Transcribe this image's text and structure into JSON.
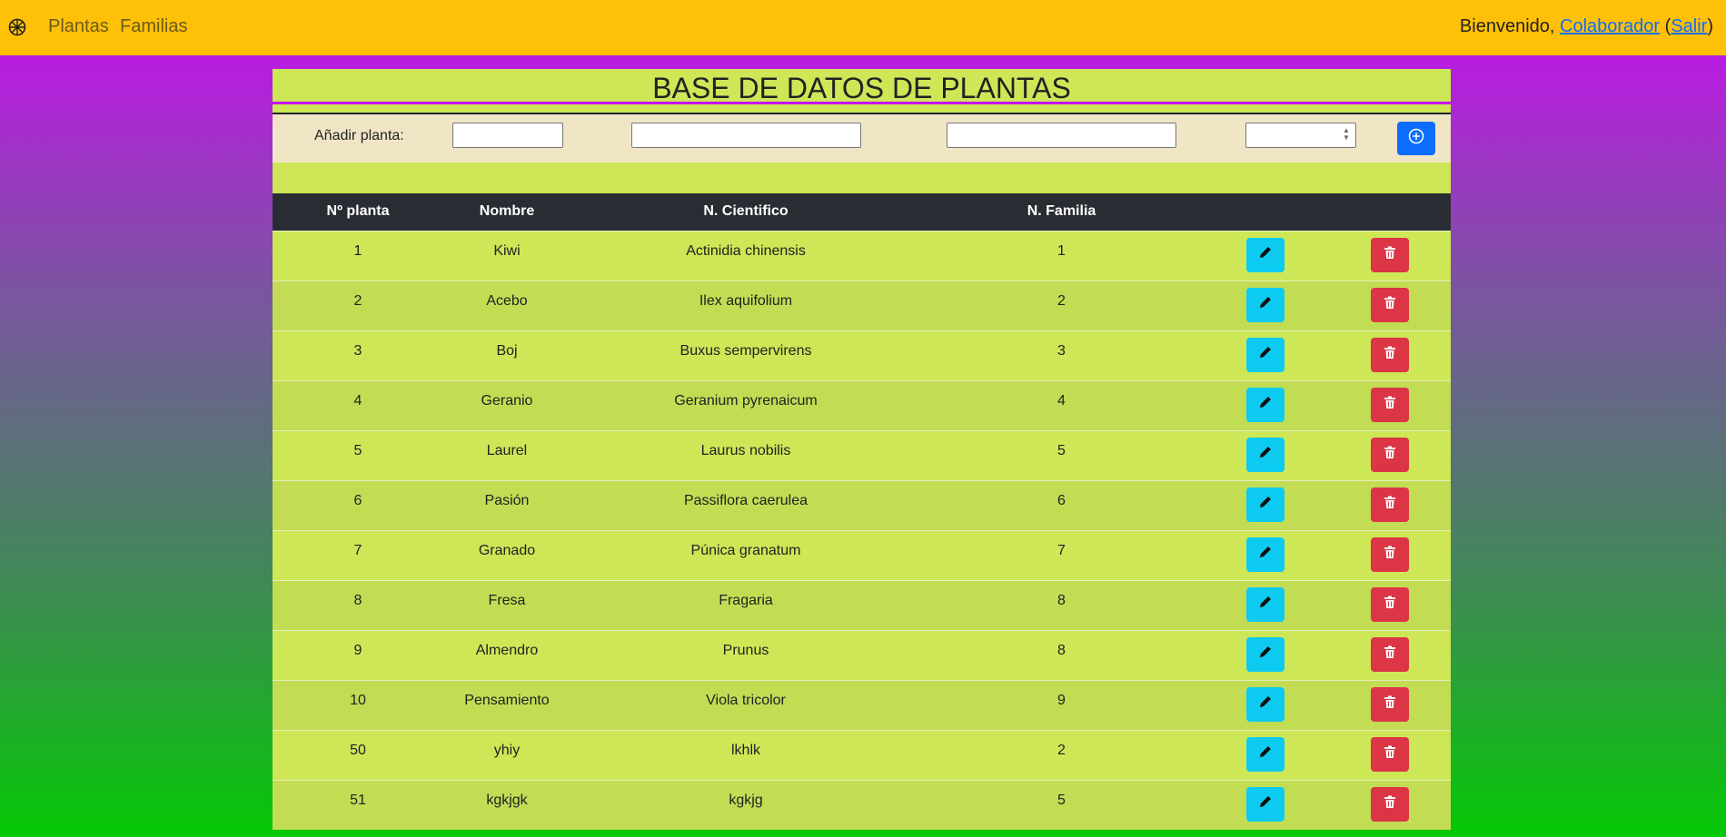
{
  "navbar": {
    "links": [
      "Plantas",
      "Familias"
    ],
    "welcome_prefix": "Bienvenido, ",
    "user": "Colaborador",
    "paren_open": "(",
    "logout": "Salir",
    "paren_close": ")"
  },
  "page": {
    "title": "BASE DE DATOS DE PLANTAS",
    "add_label": "Añadir planta:"
  },
  "table": {
    "headers": [
      "Nº planta",
      "Nombre",
      "N. Cientifico",
      "N. Familia"
    ],
    "rows": [
      {
        "id": "1",
        "nombre": "Kiwi",
        "cientifico": "Actinidia chinensis",
        "familia": "1"
      },
      {
        "id": "2",
        "nombre": "Acebo",
        "cientifico": "Ilex aquifolium",
        "familia": "2"
      },
      {
        "id": "3",
        "nombre": "Boj",
        "cientifico": "Buxus sempervirens",
        "familia": "3"
      },
      {
        "id": "4",
        "nombre": "Geranio",
        "cientifico": "Geranium pyrenaicum",
        "familia": "4"
      },
      {
        "id": "5",
        "nombre": "Laurel",
        "cientifico": "Laurus nobilis",
        "familia": "5"
      },
      {
        "id": "6",
        "nombre": "Pasión",
        "cientifico": "Passiflora caerulea",
        "familia": "6"
      },
      {
        "id": "7",
        "nombre": "Granado",
        "cientifico": "Púnica granatum",
        "familia": "7"
      },
      {
        "id": "8",
        "nombre": "Fresa",
        "cientifico": "Fragaria",
        "familia": "8"
      },
      {
        "id": "9",
        "nombre": "Almendro",
        "cientifico": "Prunus",
        "familia": "8"
      },
      {
        "id": "10",
        "nombre": "Pensamiento",
        "cientifico": "Viola tricolor",
        "familia": "9"
      },
      {
        "id": "50",
        "nombre": "yhiy",
        "cientifico": "lkhlk",
        "familia": "2"
      },
      {
        "id": "51",
        "nombre": "kgkjgk",
        "cientifico": "kgkjg",
        "familia": "5"
      }
    ]
  },
  "icons": {
    "brand": "wheel-icon",
    "add": "plus-circle-icon",
    "edit": "pencil-icon",
    "delete": "trash-icon"
  },
  "colors": {
    "navbar": "#ffc107",
    "panel": "#cde757",
    "header": "#292d33",
    "edit": "#0dcaf0",
    "delete": "#dc3545",
    "add": "#0d6efd"
  }
}
